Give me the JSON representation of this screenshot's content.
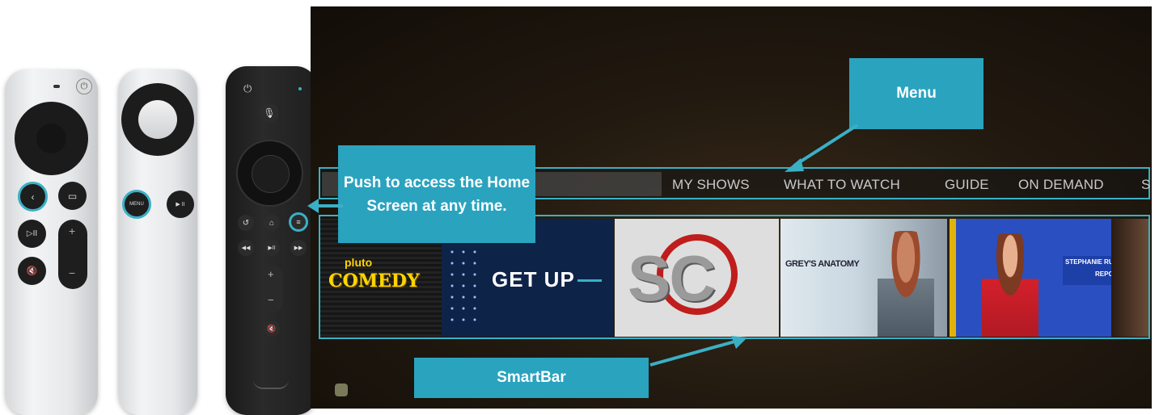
{
  "remotes": {
    "siri_remote": {
      "play_pause": "▷II",
      "plus": "+",
      "minus": "−",
      "mute": "🔇"
    },
    "silver_remote": {
      "menu": "MENU",
      "play": "▶ II"
    },
    "fire_remote": {
      "rewind": "◀◀",
      "play": "▶II",
      "forward": "▶▶",
      "plus": "+",
      "minus": "−"
    }
  },
  "tv": {
    "menu": {
      "items": [
        "MY SHOWS",
        "WHAT TO WATCH",
        "GUIDE",
        "ON DEMAND",
        "S"
      ]
    },
    "smartbar": {
      "tiles": [
        {
          "line1": "pluto",
          "line2": "COMEDY"
        },
        {
          "title": "GET UP"
        },
        {
          "title": "SC"
        },
        {
          "title": "GREY'S ANATOMY"
        },
        {
          "title1": "STEPHANIE RUHLE",
          "title2": "REPORTS"
        }
      ]
    }
  },
  "callouts": {
    "menu": "Menu",
    "home": "Push to access the Home Screen at any time.",
    "smartbar": "SmartBar"
  },
  "colors": {
    "accent": "#2aa3bf",
    "border": "#3ab0c5"
  }
}
